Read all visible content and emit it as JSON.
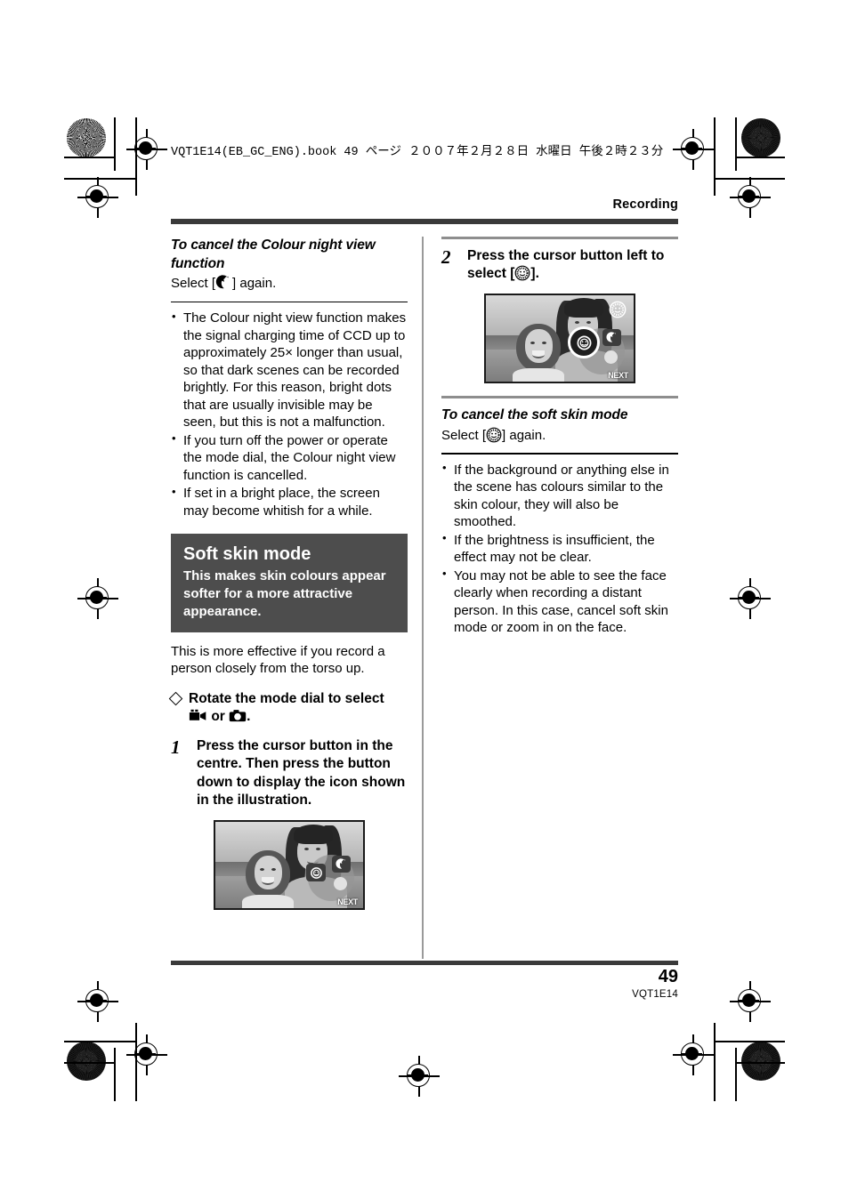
{
  "print_header": {
    "book_line": "VQT1E14(EB_GC_ENG).book   49 ページ   ２００７年２月２８日   水曜日   午後２時２３分"
  },
  "running_head": {
    "label": "Recording"
  },
  "footer": {
    "page_number": "49",
    "doc_code": "VQT1E14"
  },
  "left_column": {
    "cancel_section": {
      "heading": "To cancel the Colour night view function",
      "instruction_prefix": "Select [",
      "icon": "colour-night-view-icon",
      "instruction_suffix": "] again."
    },
    "notes": [
      "The Colour night view function makes the signal charging time of CCD up to approximately 25× longer than usual, so that dark scenes can be recorded brightly. For this reason, bright dots that are usually invisible may be seen, but this is not a malfunction.",
      "If you turn off the power or operate the mode dial, the Colour night view function is cancelled.",
      "If set in a bright place, the screen may become whitish for a while."
    ],
    "callout": {
      "title": "Soft skin mode",
      "description": "This makes skin colours appear softer for a more attractive appearance."
    },
    "intro": "This is more effective if you record a person closely from the torso up.",
    "directive": {
      "text_before": "Rotate the mode dial to select",
      "icon_1": "camcorder-mode-icon",
      "conjunction": "or",
      "icon_2": "photo-mode-icon",
      "text_after": "."
    },
    "step1": {
      "number": "1",
      "text": "Press the cursor button in the centre. Then press the button down to display the icon shown in the illustration."
    },
    "illustration": {
      "caption": "lcd-screen-soft-skin-icon-displayed",
      "osd_next_label": "NEXT",
      "osd_icons": [
        "soft-skin-icon",
        "colour-night-view-icon",
        "record-dot-icon"
      ]
    }
  },
  "right_column": {
    "step2": {
      "number": "2",
      "text_before": "Press the cursor button left to select [",
      "icon": "soft-skin-icon",
      "text_after": "]."
    },
    "illustration": {
      "caption": "lcd-screen-soft-skin-selected",
      "osd_next_label": "NEXT",
      "osd_icons": [
        "soft-skin-icon-selected",
        "colour-night-view-icon",
        "record-dot-icon",
        "soft-skin-status-icon"
      ]
    },
    "cancel_section": {
      "heading": "To cancel the soft skin mode",
      "instruction_prefix": "Select [",
      "icon": "soft-skin-icon",
      "instruction_suffix": "] again."
    },
    "notes": [
      "If the background or anything else in the scene has colours similar to the skin colour, they will also be smoothed.",
      "If the brightness is insufficient, the effect may not be clear.",
      "You may not be able to see the face clearly when recording a distant person. In this case, cancel soft skin mode or zoom in on the face."
    ]
  },
  "colors": {
    "callout_bg": "#4d4d4d",
    "rule_dark": "#3a3a3a",
    "rule_grey": "#8e8e8e"
  }
}
